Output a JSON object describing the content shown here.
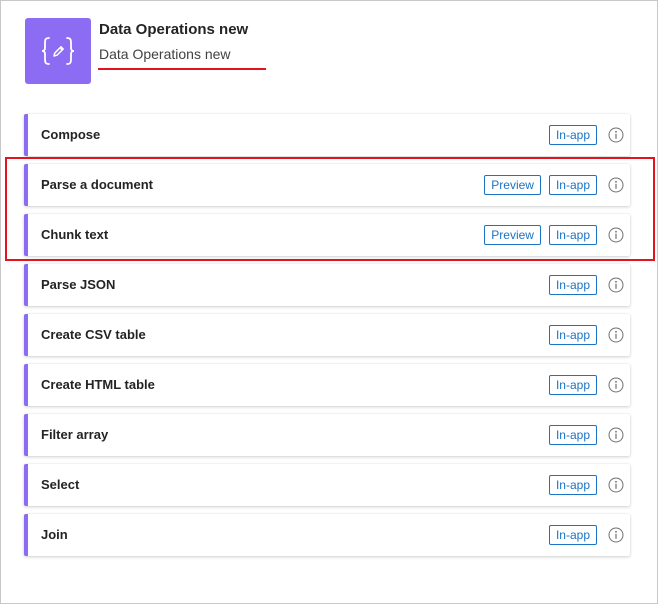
{
  "connector": {
    "title": "Data Operations new",
    "subtitle": "Data Operations new",
    "icon": "curly-braces-edit-icon",
    "color": "#8c6cf2"
  },
  "actions": [
    {
      "name": "Compose",
      "tags": [
        "In-app"
      ]
    },
    {
      "name": "Parse a document",
      "tags": [
        "Preview",
        "In-app"
      ]
    },
    {
      "name": "Chunk text",
      "tags": [
        "Preview",
        "In-app"
      ]
    },
    {
      "name": "Parse JSON",
      "tags": [
        "In-app"
      ]
    },
    {
      "name": "Create CSV table",
      "tags": [
        "In-app"
      ]
    },
    {
      "name": "Create HTML table",
      "tags": [
        "In-app"
      ]
    },
    {
      "name": "Filter array",
      "tags": [
        "In-app"
      ]
    },
    {
      "name": "Select",
      "tags": [
        "In-app"
      ]
    },
    {
      "name": "Join",
      "tags": [
        "In-app"
      ]
    }
  ],
  "colors": {
    "accent": "#8c6cf2",
    "tag": "#1a73c4",
    "annotation": "#e3141d"
  }
}
